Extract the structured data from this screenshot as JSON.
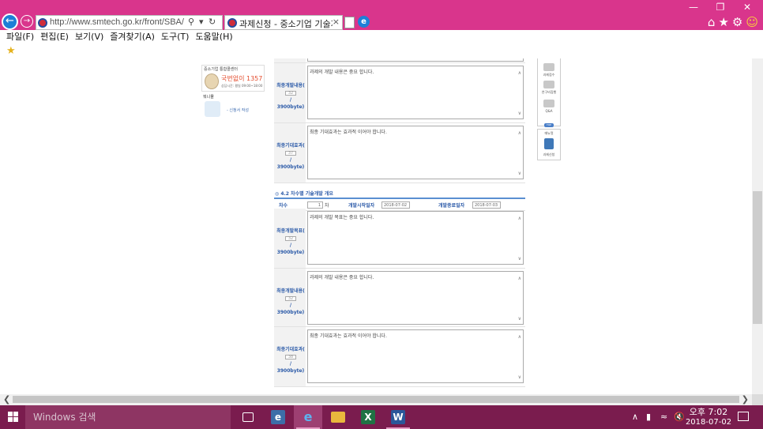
{
  "browser": {
    "url": "http://www.smtech.go.kr/front/SBA/SA/SbjtF",
    "tab_title": "과제신청 - 중소기업 기술개...",
    "menu": [
      "파일(F)",
      "편집(E)",
      "보기(V)",
      "즐겨찾기(A)",
      "도구(T)",
      "도움말(H)"
    ]
  },
  "left_banners": {
    "callcenter_title": "중소기업 통합콜센터",
    "callcenter_number": "국번없이 1357",
    "callcenter_hours": "상담시간: 평일 09:00~18:00",
    "banner2_title": "뭐니몰",
    "banner2_link": "- 신청서 작성"
  },
  "form": {
    "rows_top": [
      {
        "label": "최종개발내용(",
        "count": "32",
        "limit": "/ 3900byte)",
        "text": "과제의 개발 내용은 중요 합니다."
      },
      {
        "label": "최종기대효과(",
        "count": "37",
        "limit": "/ 3900byte)",
        "text": "최종 기대효과는 효과적 이어야 합니다."
      }
    ],
    "section_title": "4.2 차수별 기술개발 개요",
    "chasu": {
      "label": "차수",
      "value": "1",
      "unit": "차",
      "start_label": "개발시작일자",
      "start_date": "2018-07-02",
      "end_label": "개발종료일자",
      "end_date": "2018-07-03"
    },
    "rows_bottom": [
      {
        "label": "최종개발목표(",
        "count": "32",
        "limit": "/ 3900byte)",
        "text": "과제의 개발 목표는 중요 합니다."
      },
      {
        "label": "최종개발내용(",
        "count": "32",
        "limit": "/ 3900byte)",
        "text": "과제의 개발 내용은 중요 합니다."
      },
      {
        "label": "최종기대효과(",
        "count": "38",
        "limit": "/ 3900byte)",
        "text": "최종 기대효과는 효과적 이어야 합니다."
      }
    ]
  },
  "quick_menu": {
    "items": [
      "과제접수",
      "연구비집행",
      "Q&A"
    ],
    "top": "TOP",
    "manual_title": "매뉴얼",
    "manual_item": "과제신청"
  },
  "taskbar": {
    "search_placeholder": "Windows 검색",
    "time": "오후 7:02",
    "date": "2018-07-02"
  },
  "colors": {
    "titlebar": "#d9358c",
    "taskbar": "#7a1c4e",
    "form_label": "#2b5aa8"
  }
}
